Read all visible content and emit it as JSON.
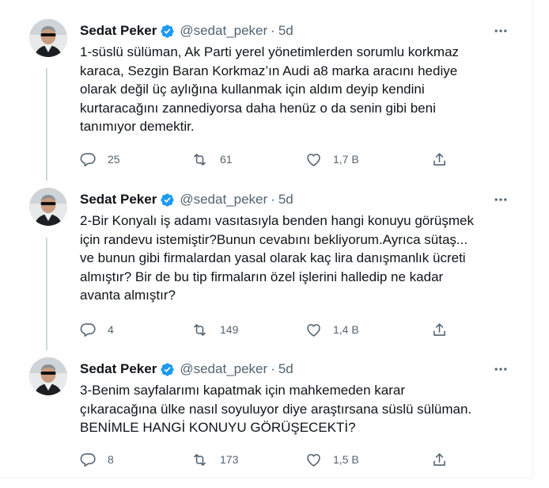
{
  "tweets": [
    {
      "name": "Sedat Peker",
      "handle": "@sedat_peker",
      "dot": "·",
      "time": "5d",
      "lines": [
        "1-süslü sülüman, Ak Parti yerel yönetimlerden sorumlu korkmaz",
        "karaca, Sezgin Baran Korkmaz’ın Audi a8 marka aracını hediye",
        "olarak değil üç aylığına kullanmak için aldım deyip kendini",
        "kurtaracağını zannediyorsa daha henüz o da senin gibi beni",
        "tanımıyor demektir."
      ],
      "replies": "25",
      "retweets": "61",
      "likes": "1,7 B"
    },
    {
      "name": "Sedat Peker",
      "handle": "@sedat_peker",
      "dot": "·",
      "time": "5d",
      "lines": [
        "2-Bir Konyalı iş adamı vasıtasıyla benden hangi konuyu görüşmek",
        "için randevu istemiştir?Bunun cevabını bekliyorum.Ayrıca sütaş...",
        "ve bunun gibi firmalardan yasal olarak kaç lira danışmanlık ücreti",
        "almıştır? Bir de bu tip firmaların özel işlerini halledip ne kadar",
        "avanta almıştır?"
      ],
      "replies": "4",
      "retweets": "149",
      "likes": "1,4 B"
    },
    {
      "name": "Sedat Peker",
      "handle": "@sedat_peker",
      "dot": "·",
      "time": "5d",
      "lines": [
        "3-Benim sayfalarımı kapatmak için mahkemeden karar",
        "çıkaracağına ülke nasıl soyuluyor diye araştırsana süslü sülüman.",
        "BENİMLE HANGİ KONUYU GÖRÜŞECEKTİ?"
      ],
      "replies": "8",
      "retweets": "173",
      "likes": "1,5 B"
    }
  ],
  "icons": {
    "verified": "verified-badge-icon",
    "more": "more-options-icon",
    "reply": "reply-icon",
    "retweet": "retweet-icon",
    "like": "like-icon",
    "share": "share-icon"
  },
  "colors": {
    "verified": "#1d9bf0",
    "text": "#0f1419",
    "secondary": "#536471",
    "thread_line": "#cfd9de"
  }
}
